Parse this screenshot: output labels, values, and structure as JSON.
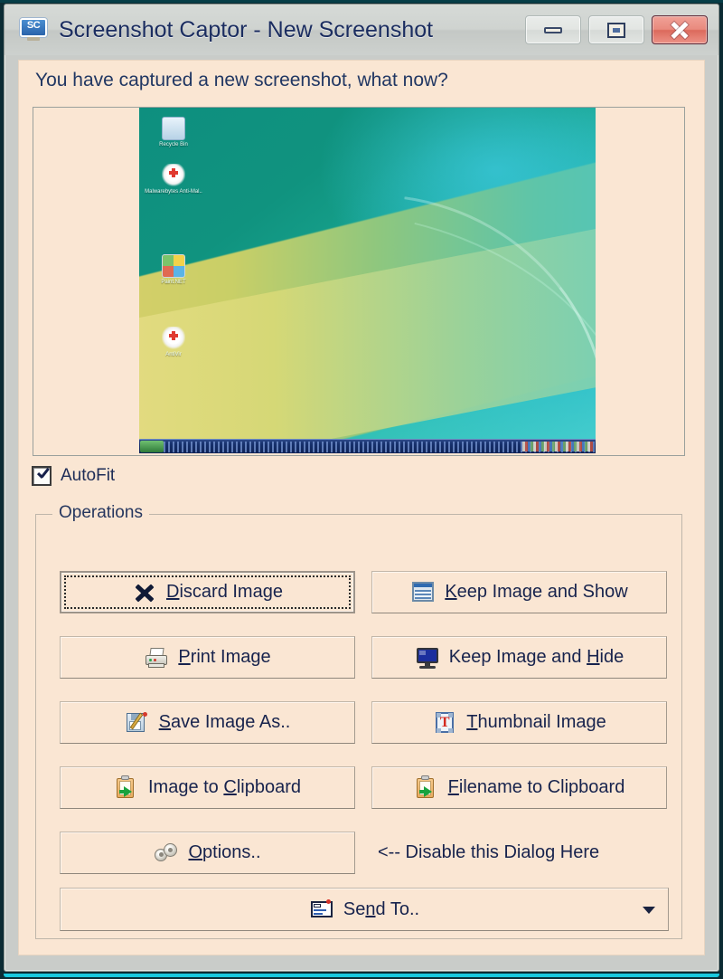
{
  "window": {
    "title": "Screenshot Captor - New Screenshot",
    "app_icon": "screenshot-captor-icon",
    "icon_text": "SC",
    "controls": {
      "minimize": "minimize-icon",
      "maximize": "maximize-icon",
      "close": "close-icon"
    }
  },
  "prompt": "You have captured a new screenshot, what now?",
  "preview": {
    "name": "captured-screenshot-preview",
    "desktop_icons": [
      {
        "label": "Recycle Bin"
      },
      {
        "label": "Malwarebytes Anti-Mal.."
      },
      {
        "label": "Paint.NET"
      },
      {
        "label": "AntiVir"
      }
    ]
  },
  "autofit": {
    "label": "AutoFit",
    "checked": true
  },
  "operations": {
    "group_label": "Operations",
    "buttons": [
      {
        "id": "discard-image",
        "label": "Discard Image",
        "accel_index": 0,
        "icon": "cross-icon",
        "column": "left",
        "row": 1,
        "focused": true
      },
      {
        "id": "keep-image-show",
        "label": "Keep Image and Show",
        "accel_index": 0,
        "icon": "window-icon",
        "column": "right",
        "row": 1,
        "focused": false
      },
      {
        "id": "print-image",
        "label": "Print Image",
        "accel_index": 0,
        "icon": "printer-icon",
        "column": "left",
        "row": 2,
        "focused": false
      },
      {
        "id": "keep-image-hide",
        "label": "Keep Image and Hide",
        "accel_index": 15,
        "icon": "monitor-icon",
        "column": "right",
        "row": 2,
        "focused": false
      },
      {
        "id": "save-image-as",
        "label": "Save Image As..",
        "accel_index": 0,
        "icon": "save-disk-pencil-icon",
        "column": "left",
        "row": 3,
        "focused": false
      },
      {
        "id": "thumbnail-image",
        "label": "Thumbnail Image",
        "accel_index": 0,
        "icon": "thumbnail-icon",
        "column": "right",
        "row": 3,
        "focused": false
      },
      {
        "id": "image-to-clipboard",
        "label": "Image to Clipboard",
        "accel_index": 9,
        "icon": "clipboard-arrow-icon",
        "column": "left",
        "row": 4,
        "focused": false
      },
      {
        "id": "filename-to-clipboard",
        "label": "Filename to Clipboard",
        "accel_index": 0,
        "icon": "clipboard-arrow-icon",
        "column": "right",
        "row": 4,
        "focused": false
      },
      {
        "id": "options",
        "label": "Options..",
        "accel_index": 0,
        "icon": "gears-icon",
        "column": "left",
        "row": 5,
        "focused": false
      }
    ],
    "disable_note": "<-- Disable this Dialog Here",
    "send_to": {
      "label": "Send To..",
      "icon": "send-card-icon",
      "dropdown_icon": "chevron-down-icon"
    },
    "labels": {
      "discard_image": {
        "pre": "",
        "accel": "D",
        "post": "iscard Image"
      },
      "keep_image_show": {
        "pre": "",
        "accel": "K",
        "post": "eep Image and Show"
      },
      "print_image": {
        "pre": "",
        "accel": "P",
        "post": "rint Image"
      },
      "keep_image_hide": {
        "pre": "Keep Image and ",
        "accel": "H",
        "post": "ide"
      },
      "save_image_as": {
        "pre": "",
        "accel": "S",
        "post": "ave Image As.."
      },
      "thumbnail_image": {
        "pre": "",
        "accel": "T",
        "post": "humbnail Image"
      },
      "image_to_clipboard": {
        "pre": "Image to ",
        "accel": "C",
        "post": "lipboard"
      },
      "filename_to_clipboard": {
        "pre": "",
        "accel": "F",
        "post": "ilename to Clipboard"
      },
      "options": {
        "pre": "",
        "accel": "O",
        "post": "ptions.."
      },
      "send_to": {
        "pre": "Se",
        "accel": "n",
        "post": "d To.."
      }
    }
  },
  "colors": {
    "client_background": "#fae6d3",
    "title_text": "#1b2d60",
    "text": "#17234d",
    "close_button": "#e98a7e",
    "frame": "#c9ccc9",
    "accent_edge": "#19c8de"
  }
}
